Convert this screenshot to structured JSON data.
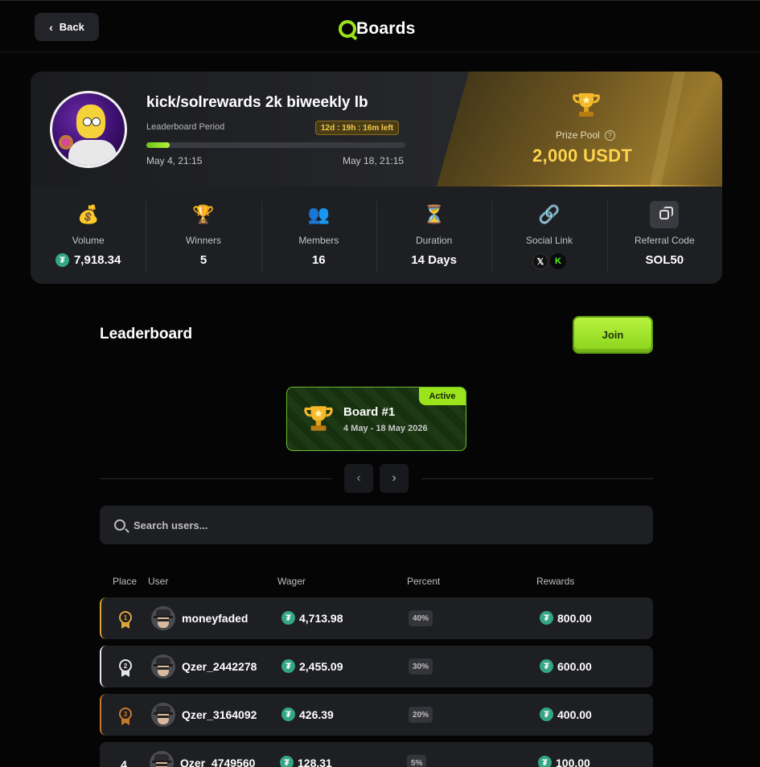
{
  "nav": {
    "back_label": "Back",
    "logo_text": "Boards"
  },
  "header": {
    "title": "kick/solrewards 2k biweekly lb",
    "period_label": "Leaderboard Period",
    "time_left": "12d : 19h : 16m left",
    "progress_fraction": 0.09,
    "start_date": "May 4, 21:15",
    "end_date": "May 18, 21:15",
    "prize_label": "Prize Pool",
    "prize_value": "2,000 USDT"
  },
  "stats": [
    {
      "icon": "money-bag-icon",
      "label": "Volume",
      "value": "7,918.34"
    },
    {
      "icon": "trophy-icon",
      "label": "Winners",
      "value": "5"
    },
    {
      "icon": "members-icon",
      "label": "Members",
      "value": "16"
    },
    {
      "icon": "hourglass-icon",
      "label": "Duration",
      "value": "14 Days"
    },
    {
      "icon": "link-icon",
      "label": "Social Link"
    },
    {
      "icon": "copy-icon",
      "label": "Referral Code",
      "value": "SOL50"
    }
  ],
  "leaderboard": {
    "title": "Leaderboard",
    "join_label": "Join",
    "board": {
      "tag": "Active",
      "name": "Board #1",
      "dates": "4 May - 18 May 2026"
    },
    "search_placeholder": "Search users...",
    "columns": {
      "place": "Place",
      "user": "User",
      "wager": "Wager",
      "percent": "Percent",
      "rewards": "Rewards"
    },
    "rows": [
      {
        "place": "1",
        "user": "moneyfaded",
        "wager": "4,713.98",
        "percent": "40%",
        "reward": "800.00"
      },
      {
        "place": "2",
        "user": "Qzer_2442278",
        "wager": "2,455.09",
        "percent": "30%",
        "reward": "600.00"
      },
      {
        "place": "3",
        "user": "Qzer_3164092",
        "wager": "426.39",
        "percent": "20%",
        "reward": "400.00"
      },
      {
        "place": "4",
        "user": "Qzer_4749560",
        "wager": "128.31",
        "percent": "5%",
        "reward": "100.00"
      }
    ]
  },
  "colors": {
    "accent": "#9be31a",
    "gold": "#ffd44d",
    "first": "#e0a53a",
    "second": "#e6e6e6",
    "third": "#c8782a",
    "tether": "#35a684"
  }
}
